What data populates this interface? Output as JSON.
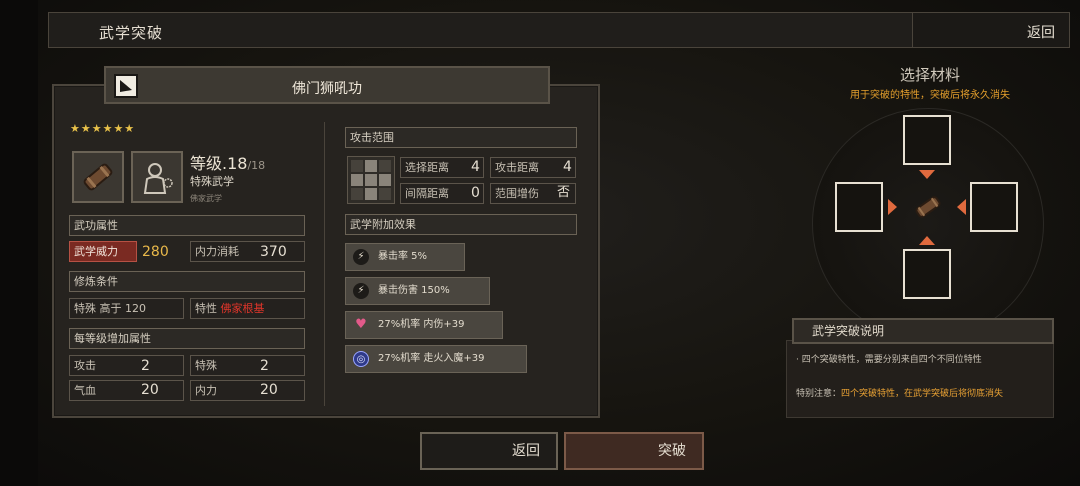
{
  "header": {
    "title": "武学突破",
    "back_label": "返回"
  },
  "skill": {
    "name": "佛门狮吼功",
    "stars": "★★★★★★",
    "level_prefix": "等级",
    "level": ".18",
    "level_max": "/18",
    "category": "特殊武学",
    "subcategory": "佛家武学"
  },
  "attributes": {
    "section_label": "武功属性",
    "power_label": "武学威力",
    "power_value": "280",
    "mp_cost_label": "内力消耗",
    "mp_cost_value": "370"
  },
  "requirements": {
    "section_label": "修炼条件",
    "req1": "特殊 高于 120",
    "req2_label": "特性",
    "req2_value": "佛家根基"
  },
  "per_level": {
    "section_label": "每等级增加属性",
    "rows": [
      {
        "label": "攻击",
        "value": "2"
      },
      {
        "label": "特殊",
        "value": "2"
      },
      {
        "label": "气血",
        "value": "20"
      },
      {
        "label": "内力",
        "value": "20"
      }
    ]
  },
  "attack_range": {
    "section_label": "攻击范围",
    "select_dist_label": "选择距离",
    "select_dist_value": "4",
    "attack_dist_label": "攻击距离",
    "attack_dist_value": "4",
    "interval_label": "间隔距离",
    "interval_value": "0",
    "aoe_label": "范围增伤",
    "aoe_value": "否"
  },
  "effects": {
    "section_label": "武学附加效果",
    "items": [
      {
        "text": "暴击率 5%",
        "icon": "lightning-icon"
      },
      {
        "text": "暴击伤害 150%",
        "icon": "lightning-icon"
      },
      {
        "text": "27%机率 内伤+39",
        "icon": "broken-heart-icon"
      },
      {
        "text": "27%机率 走火入魔+39",
        "icon": "spiral-icon"
      }
    ]
  },
  "materials": {
    "title": "选择材料",
    "subtitle": "用于突破的特性，突破后将永久消失"
  },
  "explain": {
    "title": "武学突破说明",
    "line1": "· 四个突破特性，需要分别来自四个不同位特性",
    "line2_prefix": "特别注意：",
    "line2_highlight": "四个突破特性，在武学突破后将彻底消失"
  },
  "buttons": {
    "back": "返回",
    "breakthrough": "突破"
  },
  "colors": {
    "accent": "#e39e2c",
    "red": "#e0352a",
    "gold": "#e9b94a"
  }
}
